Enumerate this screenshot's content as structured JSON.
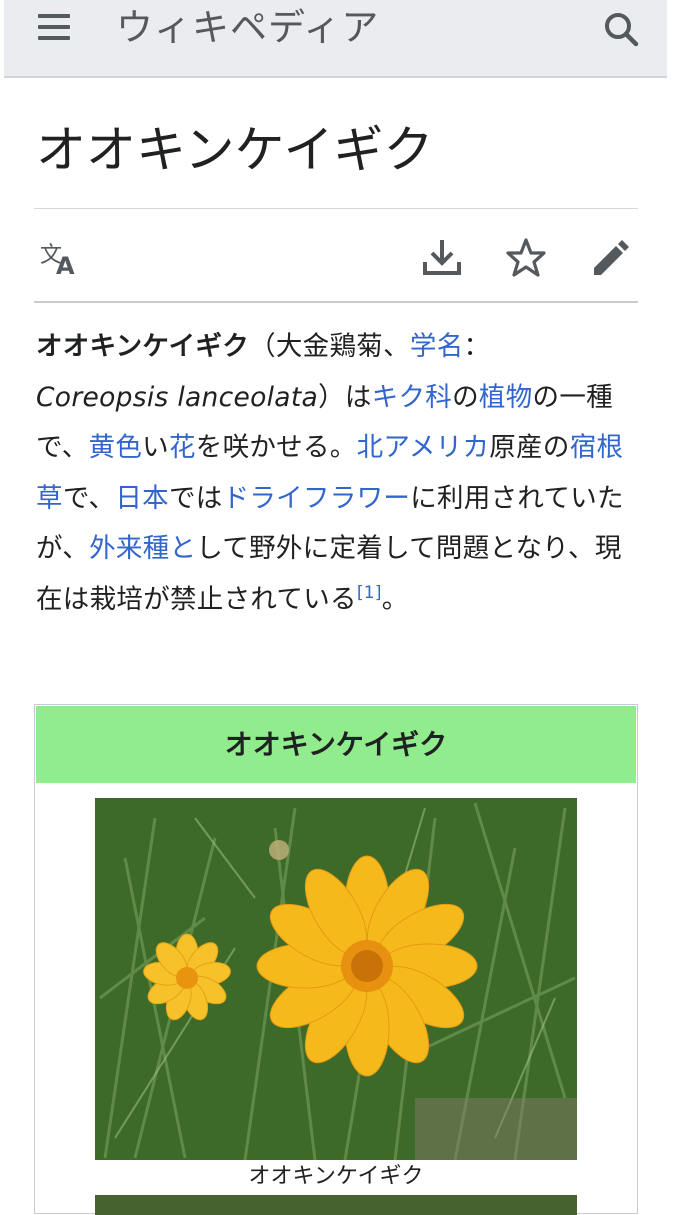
{
  "header": {
    "wordmark": "ウィキペディア",
    "menu_icon": "hamburger-menu-icon",
    "search_icon": "search-icon"
  },
  "article": {
    "title": "オオキンケイギク",
    "actions": {
      "language_icon": "language-icon",
      "download_icon": "download-icon",
      "watch_icon": "star-icon",
      "edit_icon": "pencil-icon"
    },
    "intro": {
      "term": "オオキンケイギク",
      "p1": "（大金鶏菊、",
      "link_scientific_name": "学名",
      "p2": "：",
      "latin_name": "Coreopsis lanceolata",
      "p3": "）は",
      "link_asteraceae": "キク科",
      "p4": "の",
      "link_plant": "植物",
      "p5": "の一種で、",
      "link_yellow": "黄色",
      "p6": "い",
      "link_flower": "花",
      "p7": "を咲かせる。",
      "link_north_america": "北アメリカ",
      "p8": "原産の",
      "link_perennial": "宿根草",
      "p9": "で、",
      "link_japan": "日本",
      "p10": "では",
      "link_dried_flower": "ドライフラワー",
      "p11": "に利用されていたが、",
      "link_alien_species": "外来種と",
      "p12": "して野外に定着して問題となり、現在は栽培が禁止されている",
      "footnote": "[1]",
      "p13": "。"
    },
    "infobox": {
      "title": "オオキンケイギク",
      "image_caption": "オオキンケイギク"
    }
  },
  "colors": {
    "link": "#3366cc",
    "infobox_header": "#90ec8c",
    "header_bg": "#eaecf0",
    "icon": "#54595d"
  }
}
